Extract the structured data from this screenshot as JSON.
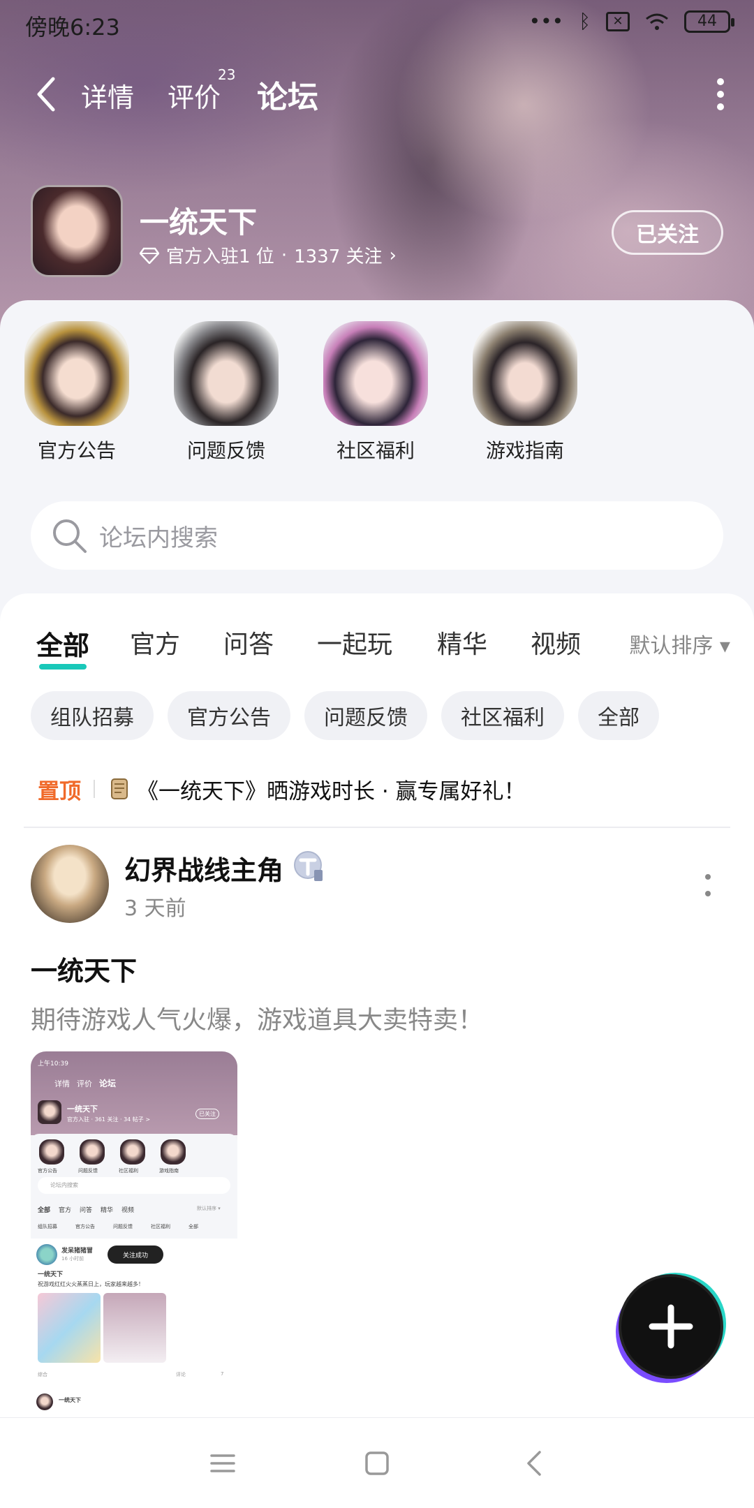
{
  "status_bar": {
    "time": "傍晚6:23",
    "battery": "44"
  },
  "top_nav": {
    "tabs": [
      {
        "label": "详情",
        "badge": ""
      },
      {
        "label": "评价",
        "badge": "23"
      },
      {
        "label": "论坛",
        "badge": ""
      }
    ],
    "active_tab": "论坛"
  },
  "forum": {
    "title": "一统天下",
    "official_text": "官方入驻1 位",
    "separator": "·",
    "followers_text": "1337 关注",
    "follow_button": "已关注"
  },
  "shortcuts": [
    {
      "label": "官方公告",
      "icon": "character-avatar"
    },
    {
      "label": "问题反馈",
      "icon": "character-avatar"
    },
    {
      "label": "社区福利",
      "icon": "character-avatar"
    },
    {
      "label": "游戏指南",
      "icon": "character-avatar"
    }
  ],
  "search": {
    "placeholder": "论坛内搜索"
  },
  "content_tabs": [
    "全部",
    "官方",
    "问答",
    "一起玩",
    "精华",
    "视频"
  ],
  "active_content_tab": "全部",
  "sort_label": "默认排序 ▾",
  "chips": [
    "组队招募",
    "官方公告",
    "问题反馈",
    "社区福利",
    "全部"
  ],
  "pinned": {
    "tag": "置顶",
    "text": "《一统天下》晒游戏时长 · 赢专属好礼！"
  },
  "post": {
    "author": "幻界战线主角",
    "time": "3 天前",
    "title": "一统天下",
    "body": "期待游戏人气火爆，游戏道具大卖特卖！"
  },
  "post_image_mini": {
    "time": "上午10:39",
    "tabs": [
      "详情",
      "评价",
      "论坛"
    ],
    "title": "一统天下",
    "meta": "官方入驻 · 361 关注 · 34 帖子 >",
    "follow": "已关注",
    "shortcuts": [
      "官方公告",
      "问题反馈",
      "社区福利",
      "游戏指南"
    ],
    "search": "论坛内搜索",
    "tabs2": [
      "全部",
      "官方",
      "问答",
      "精华",
      "视频"
    ],
    "sort": "默认排序 ▾",
    "chips": [
      "组队招募",
      "官方公告",
      "问题反馈",
      "社区福利",
      "全部"
    ],
    "author": "发呆猪猪冒",
    "post_time": "16 小时前",
    "toast": "关注成功",
    "post_title": "一统天下",
    "post_body": "祝游戏红红火火蒸蒸日上，玩家越来越多！",
    "footer_left": "综合",
    "footer_comment": "评论",
    "footer_likes": "7",
    "next_title": "一统天下"
  },
  "colors": {
    "accent": "#19c8b9",
    "pin": "#f06a2a"
  }
}
